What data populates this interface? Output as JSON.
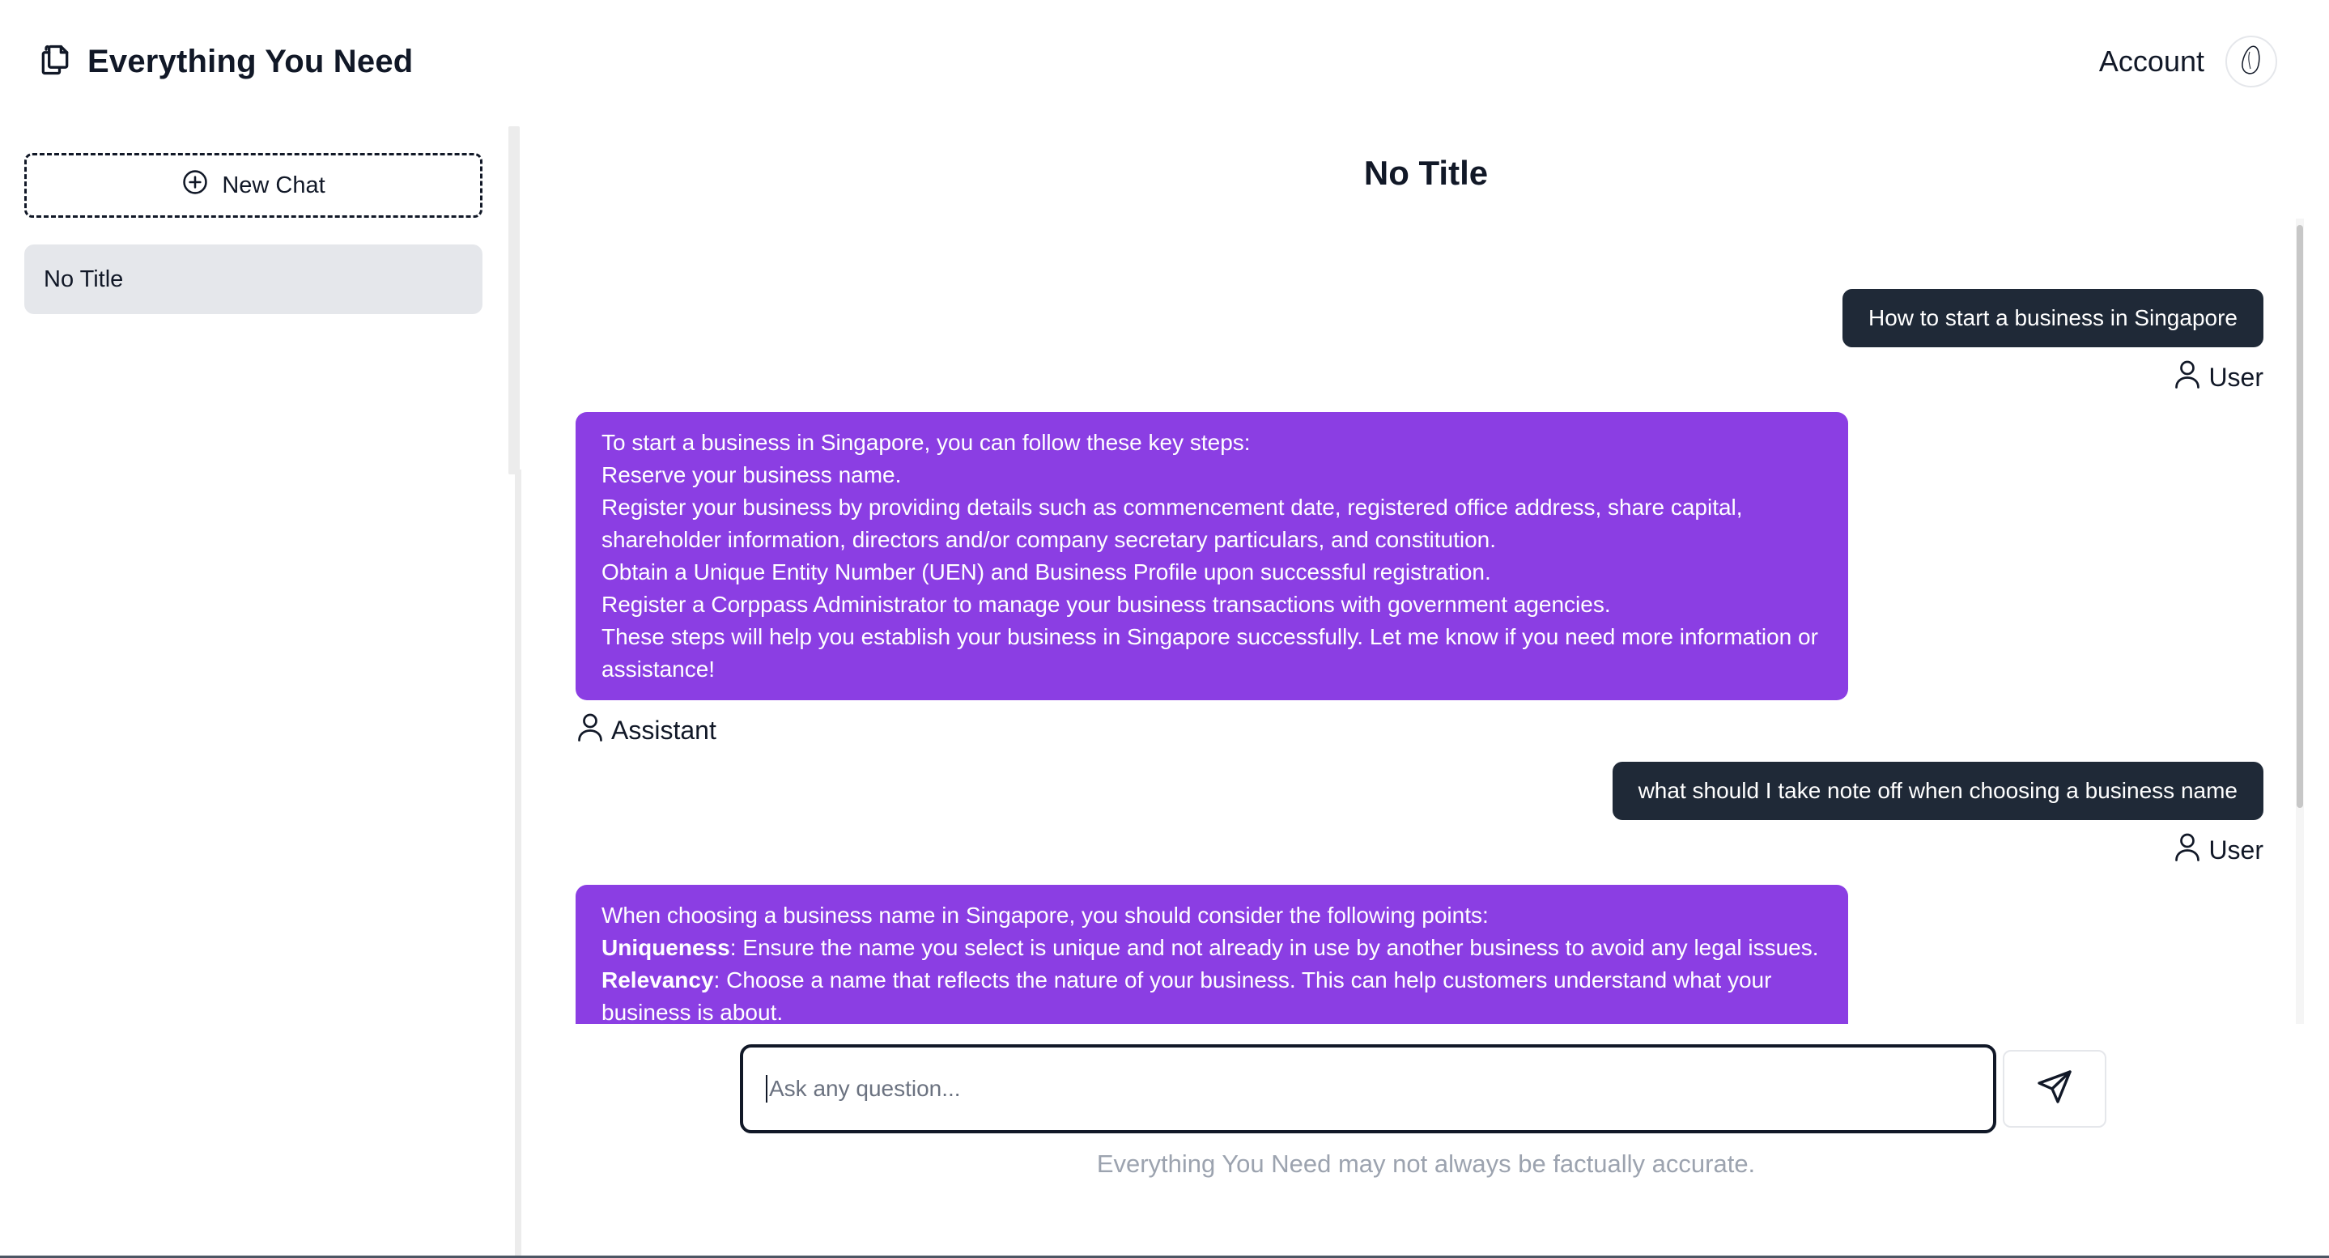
{
  "app": {
    "title": "Everything You Need",
    "account_label": "Account"
  },
  "sidebar": {
    "new_chat_label": "New Chat",
    "chats": [
      {
        "title": "No Title",
        "active": true
      }
    ]
  },
  "main": {
    "title": "No Title",
    "messages": [
      {
        "role": "User",
        "text": "How to start a business in Singapore"
      },
      {
        "role": "Assistant",
        "lines": [
          "To start a business in Singapore, you can follow these key steps:",
          "Reserve your business name.",
          "Register your business by providing details such as commencement date, registered office address, share capital, shareholder information, directors and/or company secretary particulars, and constitution.",
          "Obtain a Unique Entity Number (UEN) and Business Profile upon successful registration.",
          "Register a Corppass Administrator to manage your business transactions with government agencies.",
          "These steps will help you establish your business in Singapore successfully. Let me know if you need more information or assistance!"
        ]
      },
      {
        "role": "User",
        "text": "what should I take note off when choosing a business name"
      },
      {
        "role": "Assistant",
        "intro": "When choosing a business name in Singapore, you should consider the following points:",
        "points": [
          {
            "term": "Uniqueness",
            "text": ": Ensure the name you select is unique and not already in use by another business to avoid any legal issues."
          },
          {
            "term": "Relevancy",
            "text": ": Choose a name that reflects the nature of your business. This can help customers understand what your business is about."
          }
        ]
      }
    ]
  },
  "composer": {
    "placeholder": "Ask any question...",
    "disclaimer": "Everything You Need may not always be factually accurate."
  },
  "colors": {
    "user_bubble": "#1f2937",
    "assistant_bubble": "#8b3ee3",
    "active_chat": "#e5e7eb"
  }
}
